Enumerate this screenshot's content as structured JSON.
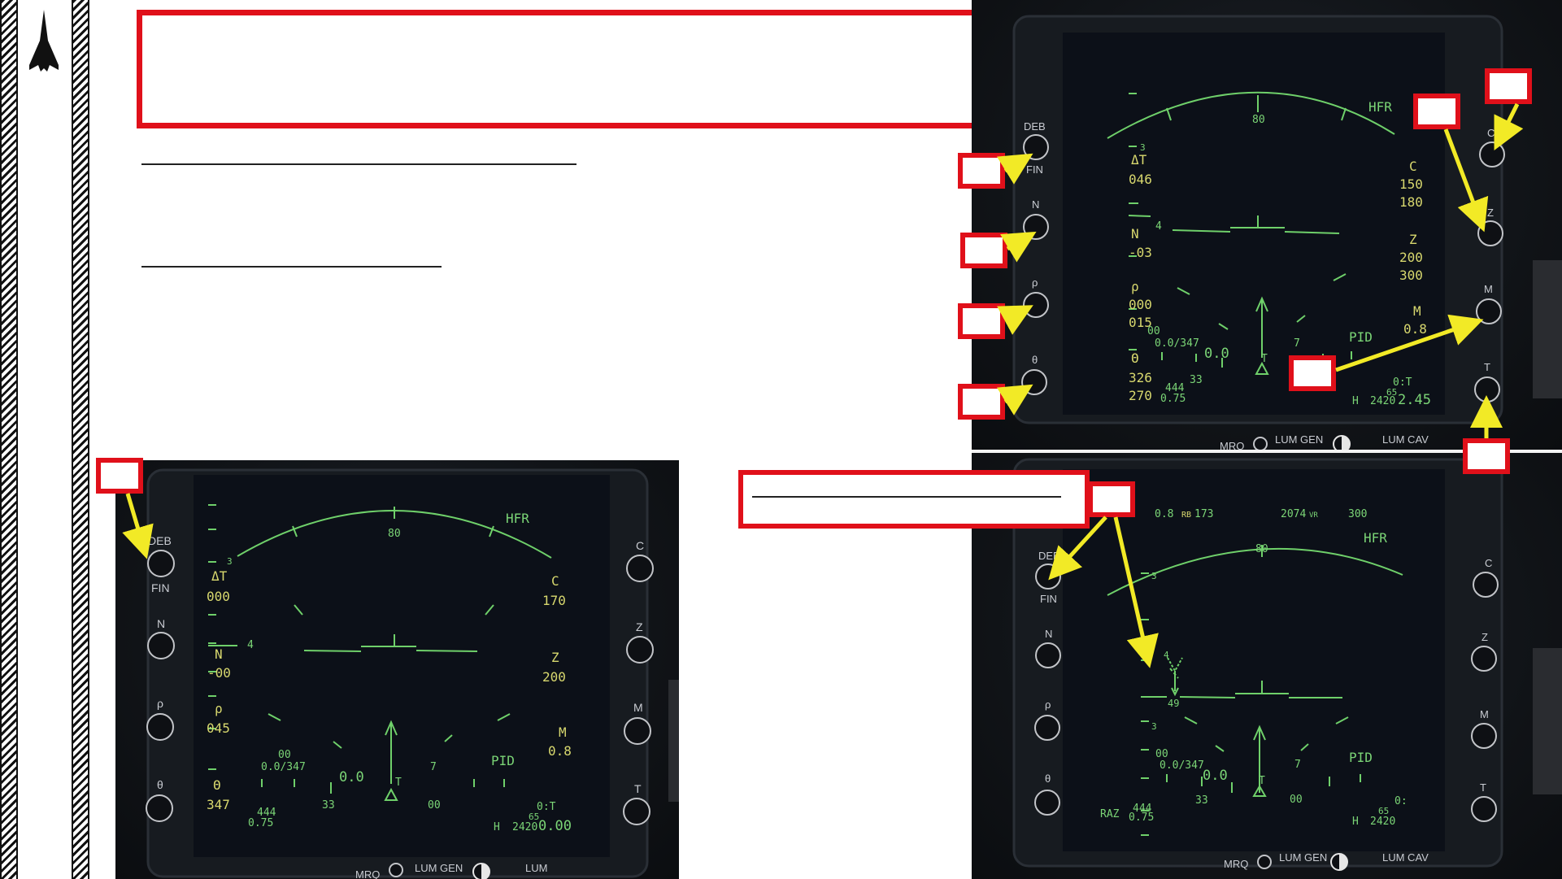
{
  "doc": {
    "title_box_text": "",
    "heading_rule_1": "",
    "heading_rule_2": "",
    "callout_text": ""
  },
  "colors": {
    "callout_red": "#e0101a",
    "hud_green": "#6fd06a",
    "hud_yellow": "#d8d86e",
    "arrow_yellow": "#f2ea26",
    "panel_bg": "#111418"
  },
  "icons": {
    "logo": "jet-silhouette-icon",
    "knob": "rotary-knob-icon",
    "brightness": "contrast-circle-icon"
  },
  "panel_top": {
    "left_knobs": [
      {
        "top": "DEB",
        "bottom": "FIN"
      },
      {
        "top": "N",
        "bottom": ""
      },
      {
        "top": "ρ",
        "bottom": ""
      },
      {
        "top": "θ",
        "bottom": ""
      }
    ],
    "right_knobs": [
      "C",
      "Z",
      "M",
      "T"
    ],
    "bottom_labels": {
      "mrq": "MRQ",
      "lum_gen": "LUM GEN",
      "lum_cav": "LUM CAV"
    },
    "hud": {
      "mode": "HFR",
      "arc_center": "80",
      "tick_3": "3",
      "tick_4": "4",
      "delta_t_label": "ΔT",
      "delta_t_value": "046",
      "n_label": "N",
      "n_value": "-03",
      "rho_label": "ρ",
      "rho_value_1": "000",
      "rho_value_2": "015",
      "theta_label": "Θ",
      "theta_value_1": "326",
      "theta_value_2": "270",
      "c_label": "C",
      "c_value_1": "150",
      "c_value_2": "180",
      "z_label": "Z",
      "z_value_1": "200",
      "z_value_2": "300",
      "m_label": "M",
      "m_value": "0.8",
      "pid": "PID",
      "ratio_top": "00",
      "ratio": "0.0/347",
      "center_value": "0.0",
      "t_marker": "T",
      "tick_33": "33",
      "tick_7": "7",
      "speed_1": "444",
      "speed_2": "0.75",
      "h_label": "H",
      "h_value": "2420",
      "ot_label": "0:T",
      "ot_65": "65",
      "ot_value": "2.45"
    }
  },
  "panel_left": {
    "left_knobs": [
      {
        "top": "DEB",
        "bottom": "FIN"
      },
      {
        "top": "N",
        "bottom": ""
      },
      {
        "top": "ρ",
        "bottom": ""
      },
      {
        "top": "θ",
        "bottom": ""
      }
    ],
    "right_knobs": [
      "C",
      "Z",
      "M",
      "T"
    ],
    "bottom_labels": {
      "mrq": "MRQ",
      "lum_gen": "LUM GEN",
      "lum_cav": "LUM"
    },
    "hud": {
      "mode": "HFR",
      "arc_center": "80",
      "tick_3": "3",
      "tick_4": "4",
      "delta_t_label": "ΔT",
      "delta_t_value": "000",
      "n_label": "N",
      "n_value": "-00",
      "rho_label": "ρ",
      "rho_value_1": "045",
      "theta_label": "Θ",
      "theta_value_1": "347",
      "c_label": "C",
      "c_value_1": "170",
      "z_label": "Z",
      "z_value_1": "200",
      "m_label": "M",
      "m_value": "0.8",
      "pid": "PID",
      "ratio_top": "00",
      "ratio": "0.0/347",
      "center_value": "0.0",
      "t_marker": "T",
      "tick_33": "33",
      "tick_7": "7",
      "tick_00": "00",
      "speed_1": "444",
      "speed_2": "0.75",
      "h_label": "H",
      "h_value": "2420",
      "ot_label": "0:T",
      "ot_65": "65",
      "ot_value": "0.00"
    }
  },
  "panel_bottom": {
    "left_knobs": [
      {
        "top": "DEB",
        "bottom": "FIN"
      },
      {
        "top": "N",
        "bottom": ""
      },
      {
        "top": "ρ",
        "bottom": ""
      },
      {
        "top": "θ",
        "bottom": ""
      }
    ],
    "right_knobs": [
      "C",
      "Z",
      "M",
      "T"
    ],
    "bottom_labels": {
      "mrq": "MRQ",
      "lum_gen": "LUM GEN",
      "lum_cav": "LUM CAV"
    },
    "hud": {
      "top_m": "0.8",
      "top_rb_label": "RB",
      "top_rb_value": "173",
      "top_alt": "2074",
      "top_alt_unit": "VR",
      "top_speed": "300",
      "mode": "HFR",
      "arc_center": "80",
      "tick_3": "3",
      "tick_4": "4",
      "tick_3b": "3",
      "target_value": "49",
      "pid": "PID",
      "ratio_top": "00",
      "ratio": "0.0/347",
      "center_value": "0.0",
      "t_marker": "T",
      "tick_33": "33",
      "tick_7": "7",
      "tick_00": "00",
      "raz": "RAZ",
      "speed_1": "444",
      "speed_2": "0.75",
      "h_label": "H",
      "h_value": "2420",
      "ot_65": "65",
      "ot_label": "0:"
    }
  }
}
